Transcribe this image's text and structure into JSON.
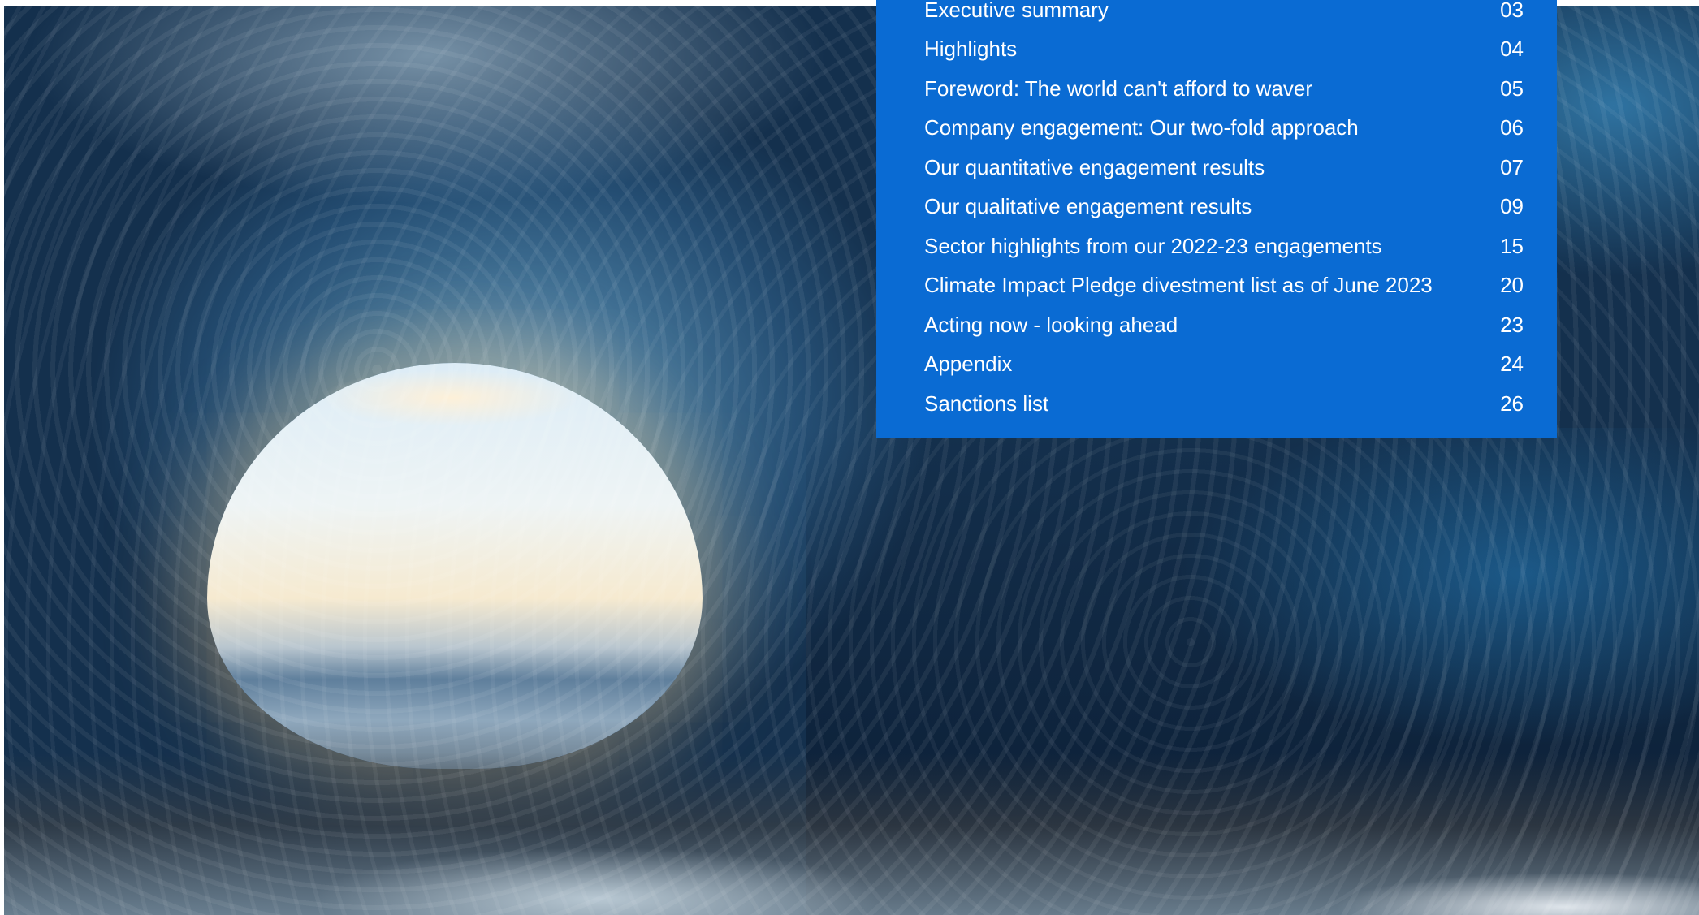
{
  "toc": {
    "items": [
      {
        "title": "Executive summary",
        "page": "03"
      },
      {
        "title": "Highlights",
        "page": "04"
      },
      {
        "title": "Foreword: The world can't afford to waver",
        "page": "05"
      },
      {
        "title": "Company engagement: Our two-fold approach",
        "page": "06"
      },
      {
        "title": "Our quantitative engagement results",
        "page": "07"
      },
      {
        "title": "Our qualitative engagement results",
        "page": "09"
      },
      {
        "title": "Sector highlights from our 2022-23 engagements",
        "page": "15"
      },
      {
        "title": "Climate Impact Pledge divestment list as of June 2023",
        "page": "20"
      },
      {
        "title": "Acting now - looking ahead",
        "page": "23"
      },
      {
        "title": "Appendix",
        "page": "24"
      },
      {
        "title": "Sanctions list",
        "page": "26"
      }
    ]
  },
  "colors": {
    "panel_blue": "#0a6bd3",
    "text": "#ffffff"
  }
}
